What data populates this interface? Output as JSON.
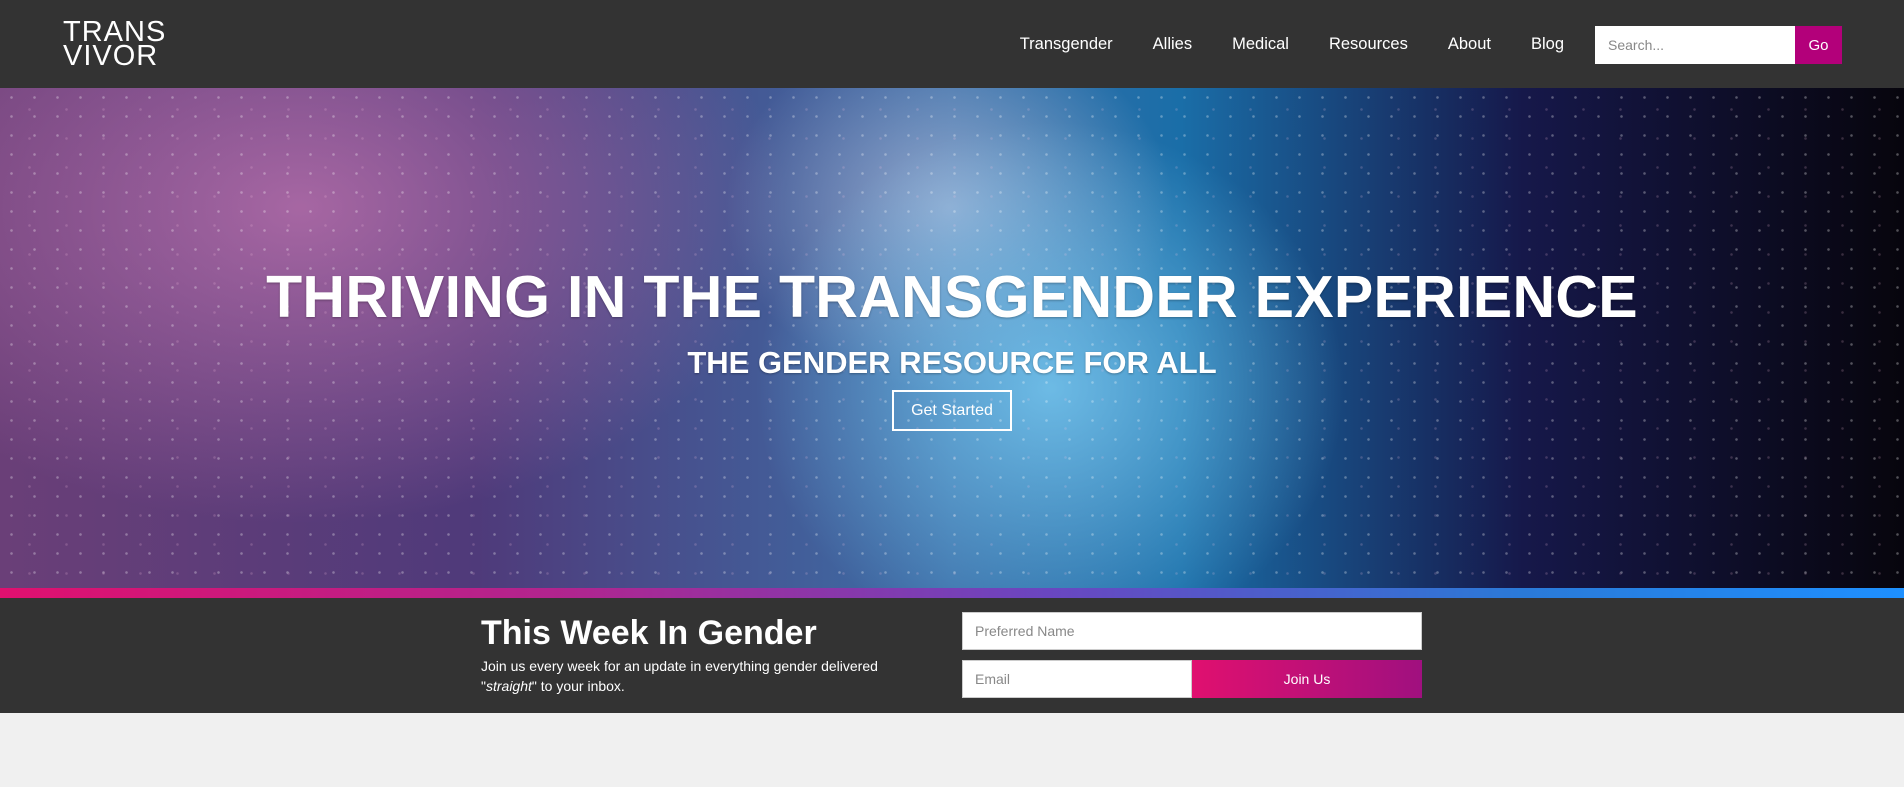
{
  "header": {
    "logo_line1": "TRANS",
    "logo_line2": "VIVOR",
    "nav": [
      "Transgender",
      "Allies",
      "Medical",
      "Resources",
      "About",
      "Blog"
    ],
    "search": {
      "placeholder": "Search...",
      "button_label": "Go"
    }
  },
  "hero": {
    "title": "THRIVING IN THE TRANSGENDER EXPERIENCE",
    "subtitle": "THE GENDER RESOURCE FOR ALL",
    "cta_label": "Get Started"
  },
  "newsletter": {
    "title": "This Week In Gender",
    "desc_before": "Join us every week for an update in everything gender delivered \"",
    "desc_em": "straight",
    "desc_after": "\" to your inbox.",
    "name_placeholder": "Preferred Name",
    "email_placeholder": "Email",
    "join_label": "Join Us"
  },
  "colors": {
    "header_bg": "#333333",
    "accent": "#b3007a",
    "page_bg": "#f0f0f0"
  }
}
